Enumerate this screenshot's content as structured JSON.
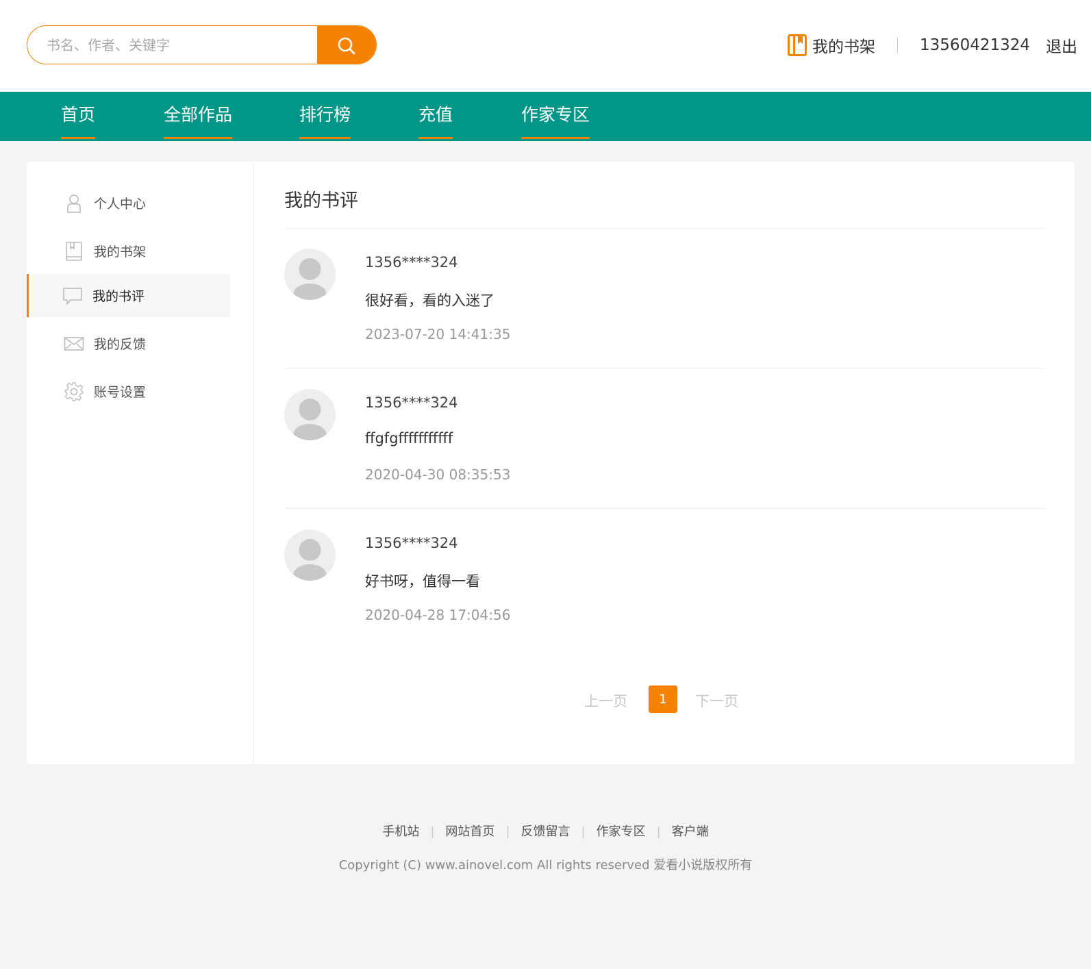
{
  "header": {
    "search_placeholder": "书名、作者、关键字",
    "shelf_label": "我的书架",
    "phone": "13560421324",
    "logout_label": "退出"
  },
  "nav": {
    "items": [
      {
        "label": "首页"
      },
      {
        "label": "全部作品"
      },
      {
        "label": "排行榜"
      },
      {
        "label": "充值"
      },
      {
        "label": "作家专区"
      }
    ]
  },
  "sidebar": {
    "items": [
      {
        "label": "个人中心",
        "icon": "user-icon"
      },
      {
        "label": "我的书架",
        "icon": "book-icon"
      },
      {
        "label": "我的书评",
        "icon": "comment-icon",
        "active": true
      },
      {
        "label": "我的反馈",
        "icon": "mail-icon"
      },
      {
        "label": "账号设置",
        "icon": "gear-icon"
      }
    ]
  },
  "main": {
    "title": "我的书评",
    "reviews": [
      {
        "user": "1356****324",
        "text": "很好看，看的入迷了",
        "time": "2023-07-20 14:41:35"
      },
      {
        "user": "1356****324",
        "text": "ffgfgfffffffffff",
        "time": "2020-04-30 08:35:53"
      },
      {
        "user": "1356****324",
        "text": "好书呀，值得一看",
        "time": "2020-04-28 17:04:56"
      }
    ],
    "pagination": {
      "prev": "上一页",
      "current": "1",
      "next": "下一页"
    }
  },
  "footer": {
    "links": [
      "手机站",
      "网站首页",
      "反馈留言",
      "作家专区",
      "客户端"
    ],
    "copyright": "Copyright (C) www.ainovel.com All rights reserved  爱看小说版权所有"
  },
  "colors": {
    "accent": "#f58200",
    "nav_bg": "#009688",
    "page_bg": "#f4f4f4"
  }
}
